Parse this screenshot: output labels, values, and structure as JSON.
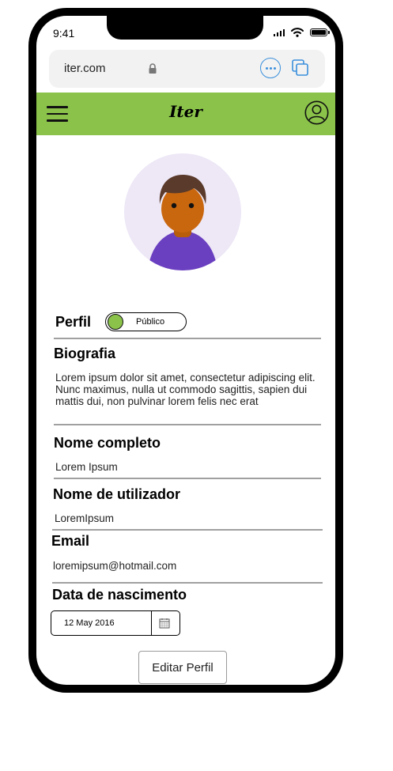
{
  "status_bar": {
    "time": "9:41"
  },
  "browser": {
    "url": "iter.com"
  },
  "app": {
    "brand": "Iter"
  },
  "profile": {
    "perfil_label": "Perfil",
    "visibility": "Público",
    "fields": {
      "bio_title": "Biografia",
      "bio_value": "Lorem ipsum dolor sit amet, consectetur adipiscing elit. Nunc maximus, nulla ut commodo sagittis, sapien dui mattis dui, non pulvinar lorem felis nec erat",
      "fullname_title": "Nome completo",
      "fullname_value": "Lorem Ipsum",
      "username_title": "Nome de utilizador",
      "username_value": "LoremIpsum",
      "email_title": "Email",
      "email_value": "loremipsum@hotmail.com",
      "birthdate_title": "Data de nascimento",
      "birthdate_value": "12 May 2016"
    },
    "edit_button": "Editar Perfil"
  },
  "colors": {
    "accent": "#8bc34a",
    "link": "#3a8fdc",
    "avatar_bg": "#ede7f6"
  },
  "icons": [
    "lock-icon",
    "more-icon",
    "tabs-icon",
    "menu-icon",
    "user-icon",
    "calendar-icon"
  ]
}
